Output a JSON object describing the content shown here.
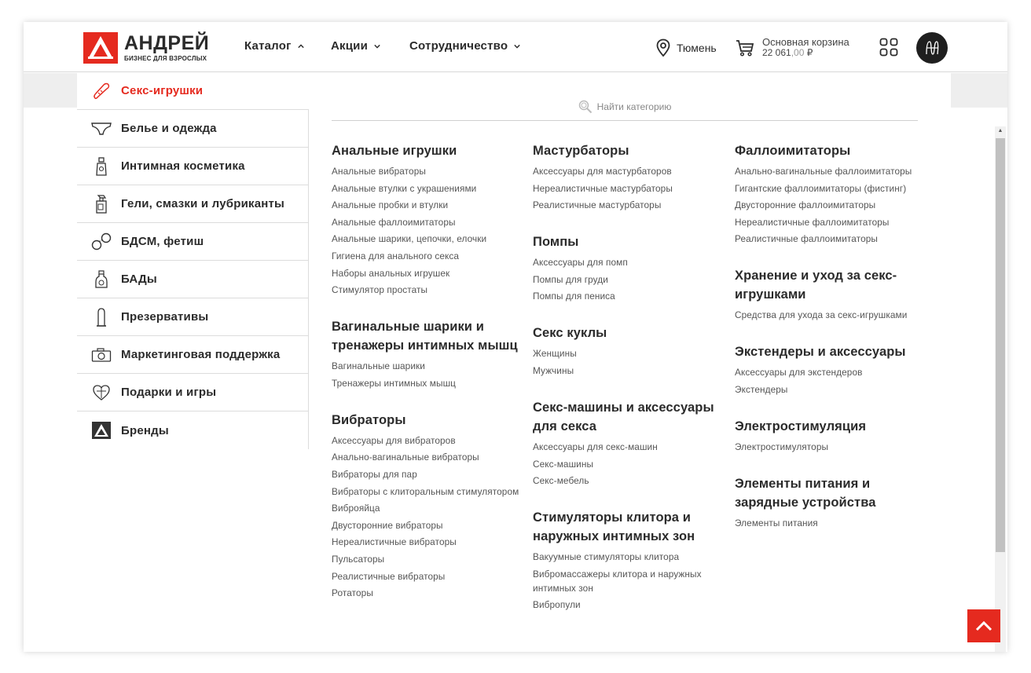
{
  "header": {
    "logo": {
      "name": "АНДРЕЙ",
      "slogan": "БИЗНЕС ДЛЯ ВЗРОСЛЫХ"
    },
    "nav": [
      {
        "label": "Каталог",
        "chevron": "up"
      },
      {
        "label": "Акции",
        "chevron": "down"
      },
      {
        "label": "Сотрудничество",
        "chevron": "down"
      }
    ],
    "city": "Тюмень",
    "cart": {
      "title": "Основная корзина",
      "amount_int": "22 061",
      "amount_dec": ",00",
      "currency": " ₽"
    }
  },
  "search": {
    "placeholder": "Найти категорию"
  },
  "categories": [
    {
      "label": "Секс-игрушки",
      "icon": "sex-toy-icon",
      "active": true
    },
    {
      "label": "Белье и одежда",
      "icon": "underwear-icon"
    },
    {
      "label": "Интимная косметика",
      "icon": "perfume-bottle-icon"
    },
    {
      "label": "Гели, смазки и лубриканты",
      "icon": "spray-bottle-icon"
    },
    {
      "label": "БДСМ, фетиш",
      "icon": "handcuffs-icon"
    },
    {
      "label": "БАДы",
      "icon": "supplement-bottle-icon"
    },
    {
      "label": "Презервативы",
      "icon": "condom-icon"
    },
    {
      "label": "Маркетинговая поддержка",
      "icon": "camera-icon"
    },
    {
      "label": "Подарки и игры",
      "icon": "heart-gift-icon"
    },
    {
      "label": "Бренды",
      "icon": "brand-logo-icon"
    }
  ],
  "columns": [
    [
      {
        "title": "Анальные игрушки",
        "items": [
          "Анальные вибраторы",
          "Анальные втулки с украшениями",
          "Анальные пробки и втулки",
          "Анальные фаллоимитаторы",
          "Анальные шарики, цепочки, елочки",
          "Гигиена для анального секса",
          "Наборы анальных игрушек",
          "Стимулятор простаты"
        ]
      },
      {
        "title": "Вагинальные шарики и тренажеры интимных мышц",
        "items": [
          "Вагинальные шарики",
          "Тренажеры интимных мышц"
        ]
      },
      {
        "title": "Вибраторы",
        "items": [
          "Аксессуары для вибраторов",
          "Анально-вагинальные вибраторы",
          "Вибраторы для пар",
          "Вибраторы с клиторальным стимулятором",
          "Виброяйца",
          "Двусторонние вибраторы",
          "Нереалистичные вибраторы",
          "Пульсаторы",
          "Реалистичные вибраторы",
          "Ротаторы"
        ]
      }
    ],
    [
      {
        "title": "Мастурбаторы",
        "items": [
          "Аксессуары для мастурбаторов",
          "Нереалистичные мастурбаторы",
          "Реалистичные мастурбаторы"
        ]
      },
      {
        "title": "Помпы",
        "items": [
          "Аксессуары для помп",
          "Помпы для груди",
          "Помпы для пениса"
        ]
      },
      {
        "title": "Секс куклы",
        "items": [
          "Женщины",
          "Мужчины"
        ]
      },
      {
        "title": "Секс-машины и аксессуары для секса",
        "items": [
          "Аксессуары для секс-машин",
          "Секс-машины",
          "Секс-мебель"
        ]
      },
      {
        "title": "Стимуляторы клитора и наружных интимных зон",
        "items": [
          "Вакуумные стимуляторы клитора",
          "Вибромассажеры клитора и наружных интимных зон",
          "Вибропули"
        ]
      }
    ],
    [
      {
        "title": "Фаллоимитаторы",
        "items": [
          "Анально-вагинальные фаллоимитаторы",
          "Гигантские фаллоимитаторы (фистинг)",
          "Двусторонние фаллоимитаторы",
          "Нереалистичные фаллоимитаторы",
          "Реалистичные фаллоимитаторы"
        ]
      },
      {
        "title": "Хранение и уход за секс-игрушками",
        "items": [
          "Средства для ухода за секс-игрушками"
        ]
      },
      {
        "title": "Экстендеры и аксессуары",
        "items": [
          "Аксессуары для экстендеров",
          "Экстендеры"
        ]
      },
      {
        "title": "Электростимуляция",
        "items": [
          "Электростимуляторы"
        ]
      },
      {
        "title": "Элементы питания и зарядные устройства",
        "items": [
          "Элементы питания"
        ]
      }
    ]
  ],
  "colors": {
    "accent": "#e52a1f",
    "text": "#2b2b2b",
    "link": "#555555"
  }
}
